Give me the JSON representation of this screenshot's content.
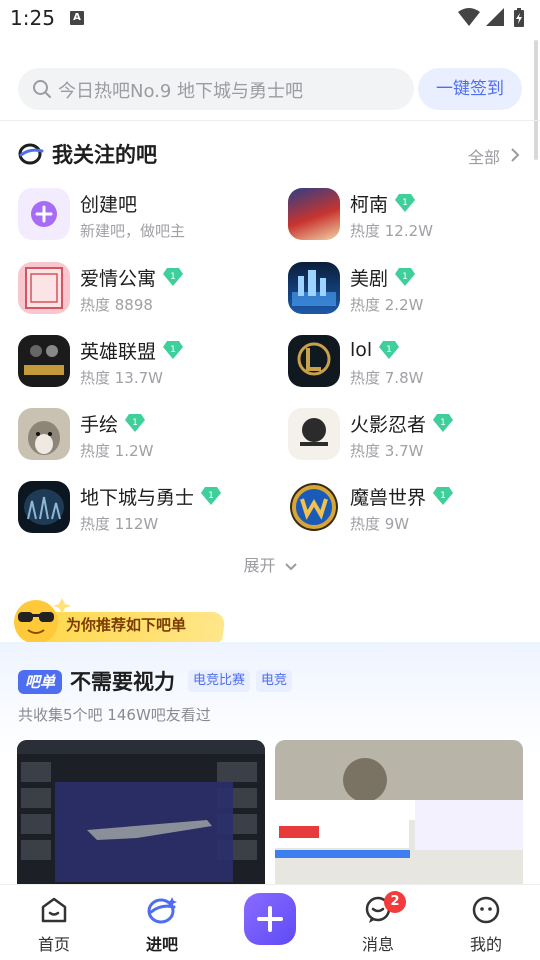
{
  "status_bar": {
    "time": "1:25",
    "notification_icon": "A"
  },
  "search": {
    "placeholder": "今日热吧No.9 地下城与勇士吧",
    "signin_label": "一键签到"
  },
  "followed": {
    "title": "我关注的吧",
    "all_label": "全部",
    "expand_label": "展开",
    "items": [
      {
        "name": "创建吧",
        "subtitle": "新建吧，做吧主",
        "level": ""
      },
      {
        "name": "柯南",
        "subtitle": "热度 12.2W",
        "level": "1"
      },
      {
        "name": "爱情公寓",
        "subtitle": "热度 8898",
        "level": "1"
      },
      {
        "name": "美剧",
        "subtitle": "热度 2.2W",
        "level": "1"
      },
      {
        "name": "英雄联盟",
        "subtitle": "热度 13.7W",
        "level": "1"
      },
      {
        "name": "lol",
        "subtitle": "热度 7.8W",
        "level": "1"
      },
      {
        "name": "手绘",
        "subtitle": "热度 1.2W",
        "level": "1"
      },
      {
        "name": "火影忍者",
        "subtitle": "热度 3.7W",
        "level": "1"
      },
      {
        "name": "地下城与勇士",
        "subtitle": "热度 112W",
        "level": "1"
      },
      {
        "name": "魔兽世界",
        "subtitle": "热度 9W",
        "level": "1"
      }
    ]
  },
  "recommend": {
    "banner_text": "为你推荐如下吧单",
    "badge": "吧单",
    "title": "不需要视力",
    "tags": [
      "电竞比赛",
      "电竞"
    ],
    "subtitle": "共收集5个吧 146W吧友看过"
  },
  "bottom_nav": {
    "items": [
      {
        "label": "首页",
        "active": false
      },
      {
        "label": "进吧",
        "active": true
      },
      {
        "label": "消息",
        "active": false,
        "badge": "2"
      },
      {
        "label": "我的",
        "active": false
      }
    ]
  },
  "colors": {
    "accent": "#4e6ef2",
    "gem": "#3fcf9a",
    "badge_red": "#f33b3b",
    "plus_button": "#6f57f8"
  }
}
